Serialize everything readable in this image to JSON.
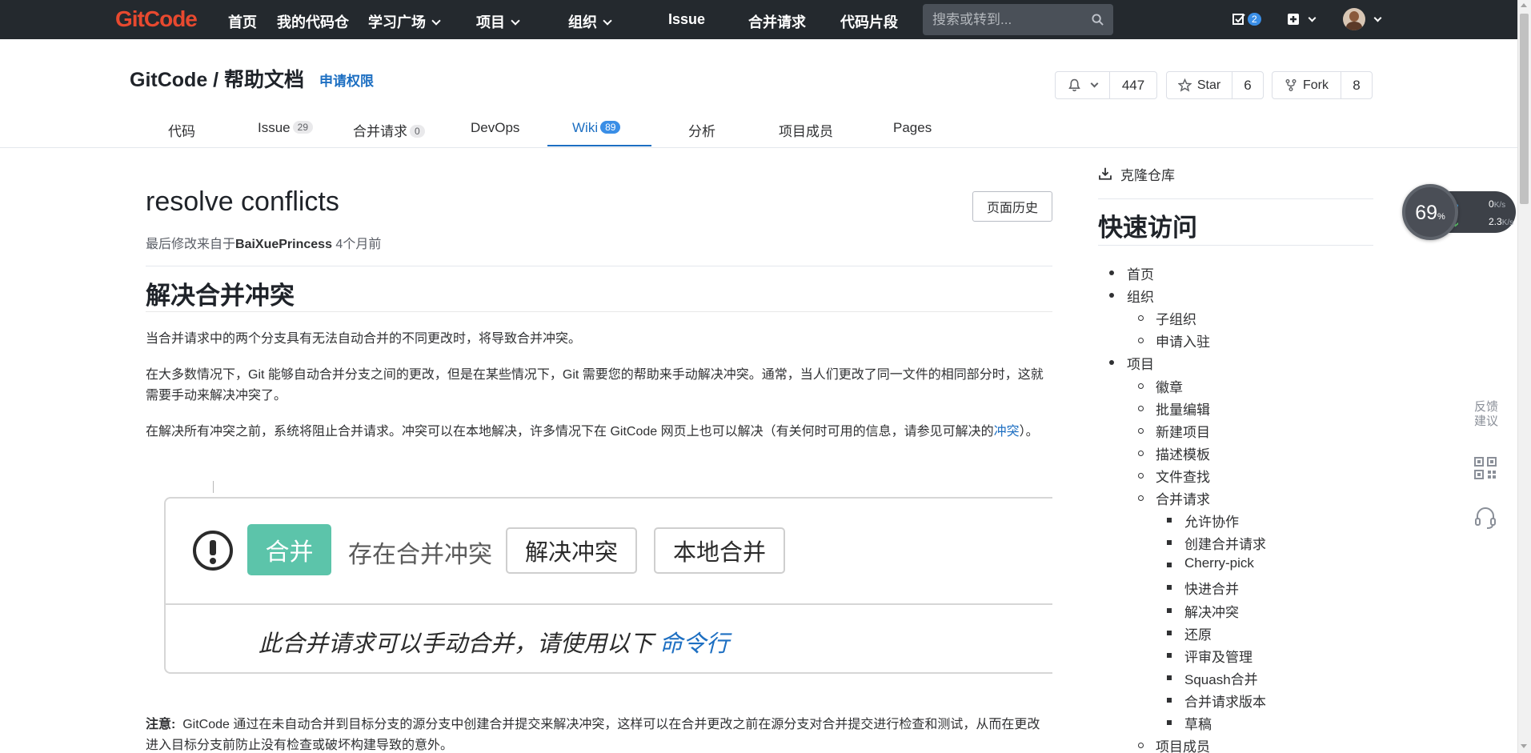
{
  "nav": {
    "logo": "GitCode",
    "items": [
      {
        "label": "首页",
        "has_caret": false
      },
      {
        "label": "我的代码仓",
        "has_caret": false
      },
      {
        "label": "学习广场",
        "has_caret": true
      },
      {
        "label": "项目",
        "has_caret": true
      },
      {
        "label": "组织",
        "has_caret": true
      },
      {
        "label": "Issue",
        "has_caret": false
      },
      {
        "label": "合并请求",
        "has_caret": false
      },
      {
        "label": "代码片段",
        "has_caret": false
      }
    ],
    "search_placeholder": "搜索或转到...",
    "todo_count": "2"
  },
  "project": {
    "title": "GitCode / 帮助文档",
    "apply_link": "申请权限",
    "watch_count": "447",
    "star_label": "Star",
    "star_count": "6",
    "fork_label": "Fork",
    "fork_count": "8"
  },
  "tabs": [
    {
      "label": "代码",
      "count": null
    },
    {
      "label": "Issue",
      "count": "29"
    },
    {
      "label": "合并请求",
      "count": "0"
    },
    {
      "label": "DevOps",
      "count": null
    },
    {
      "label": "Wiki",
      "count": "89",
      "active": true
    },
    {
      "label": "分析",
      "count": null
    },
    {
      "label": "项目成员",
      "count": null
    },
    {
      "label": "Pages",
      "count": null
    }
  ],
  "page": {
    "title": "resolve conflicts",
    "history_button": "页面历史",
    "last_modified_prefix": "最后修改来自于",
    "last_modified_user": "BaiXuePrincess",
    "last_modified_time": "4个月前",
    "heading": "解决合并冲突",
    "para1": "当合并请求中的两个分支具有无法自动合并的不同更改时，将导致合并冲突。",
    "para2": "在大多数情况下，Git 能够自动合并分支之间的更改，但是在某些情况下，Git 需要您的帮助来手动解决冲突。通常，当人们更改了同一文件的相同部分时，这就需要手动来解决冲突了。",
    "para3_before": "在解决所有冲突之前，系统将阻止合并请求。冲突可以在本地解决，许多情况下在 GitCode 网页上也可以解决（有关何时可用的信息，请参见可解决的",
    "para3_link": "冲突",
    "para3_after": "）。",
    "image": {
      "merge_badge": "合并",
      "conflict_text": "存在合并冲突",
      "resolve_button": "解决冲突",
      "local_merge_button": "本地合并",
      "manual_text": "此合并请求可以手动合并，请使用以下",
      "cmd_link": "命令行"
    },
    "note_label": "注意:",
    "note_text": "GitCode 通过在未自动合并到目标分支的源分支中创建合并提交来解决冲突，这样可以在合并更改之前在源分支对合并提交进行检查和测试，从而在更改进入目标分支前防止没有检查或破坏构建导致的意外。"
  },
  "sidebar": {
    "clone_label": "克隆仓库",
    "quick_title": "快速访问",
    "toc": [
      {
        "label": "首页",
        "level": 1
      },
      {
        "label": "组织",
        "level": 1
      },
      {
        "label": "子组织",
        "level": 2
      },
      {
        "label": "申请入驻",
        "level": 2
      },
      {
        "label": "项目",
        "level": 1
      },
      {
        "label": "徽章",
        "level": 2
      },
      {
        "label": "批量编辑",
        "level": 2
      },
      {
        "label": "新建项目",
        "level": 2
      },
      {
        "label": "描述模板",
        "level": 2
      },
      {
        "label": "文件查找",
        "level": 2
      },
      {
        "label": "合并请求",
        "level": 2
      },
      {
        "label": "允许协作",
        "level": 3
      },
      {
        "label": "创建合并请求",
        "level": 3
      },
      {
        "label": "Cherry-pick",
        "level": 3
      },
      {
        "label": "快进合并",
        "level": 3
      },
      {
        "label": "解决冲突",
        "level": 3
      },
      {
        "label": "还原",
        "level": 3
      },
      {
        "label": "评审及管理",
        "level": 3
      },
      {
        "label": "Squash合并",
        "level": 3
      },
      {
        "label": "合并请求版本",
        "level": 3
      },
      {
        "label": "草稿",
        "level": 3
      },
      {
        "label": "项目成员",
        "level": 2
      }
    ]
  },
  "widget": {
    "percent": "69",
    "percent_unit": "%",
    "up_speed": "0",
    "down_speed": "2.3",
    "speed_unit": "K/s"
  },
  "float_tools": {
    "feedback": "反馈建议"
  },
  "colors": {
    "nav_bg": "#24292e",
    "logo": "#e8492f",
    "accent": "#1d6fc2",
    "merge_green": "#5cc4aa"
  }
}
